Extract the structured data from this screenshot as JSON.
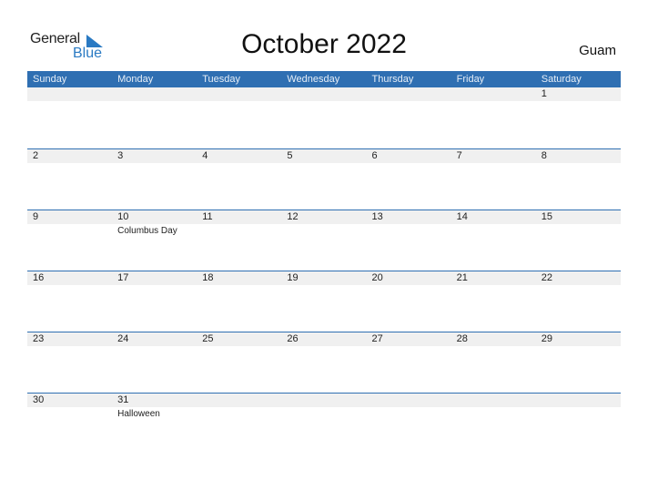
{
  "logo": {
    "line1": "General",
    "line2": "Blue"
  },
  "title": "October 2022",
  "country": "Guam",
  "weekdays": [
    "Sunday",
    "Monday",
    "Tuesday",
    "Wednesday",
    "Thursday",
    "Friday",
    "Saturday"
  ],
  "weeks": [
    [
      {
        "d": ""
      },
      {
        "d": ""
      },
      {
        "d": ""
      },
      {
        "d": ""
      },
      {
        "d": ""
      },
      {
        "d": ""
      },
      {
        "d": "1"
      }
    ],
    [
      {
        "d": "2"
      },
      {
        "d": "3"
      },
      {
        "d": "4"
      },
      {
        "d": "5"
      },
      {
        "d": "6"
      },
      {
        "d": "7"
      },
      {
        "d": "8"
      }
    ],
    [
      {
        "d": "9"
      },
      {
        "d": "10",
        "h": "Columbus Day"
      },
      {
        "d": "11"
      },
      {
        "d": "12"
      },
      {
        "d": "13"
      },
      {
        "d": "14"
      },
      {
        "d": "15"
      }
    ],
    [
      {
        "d": "16"
      },
      {
        "d": "17"
      },
      {
        "d": "18"
      },
      {
        "d": "19"
      },
      {
        "d": "20"
      },
      {
        "d": "21"
      },
      {
        "d": "22"
      }
    ],
    [
      {
        "d": "23"
      },
      {
        "d": "24"
      },
      {
        "d": "25"
      },
      {
        "d": "26"
      },
      {
        "d": "27"
      },
      {
        "d": "28"
      },
      {
        "d": "29"
      }
    ],
    [
      {
        "d": "30"
      },
      {
        "d": "31",
        "h": "Halloween"
      },
      {
        "d": ""
      },
      {
        "d": ""
      },
      {
        "d": ""
      },
      {
        "d": ""
      },
      {
        "d": ""
      }
    ]
  ],
  "colors": {
    "accent": "#2f6fb2",
    "band": "#f0f0f0",
    "logo_blue": "#2a7ac3"
  }
}
